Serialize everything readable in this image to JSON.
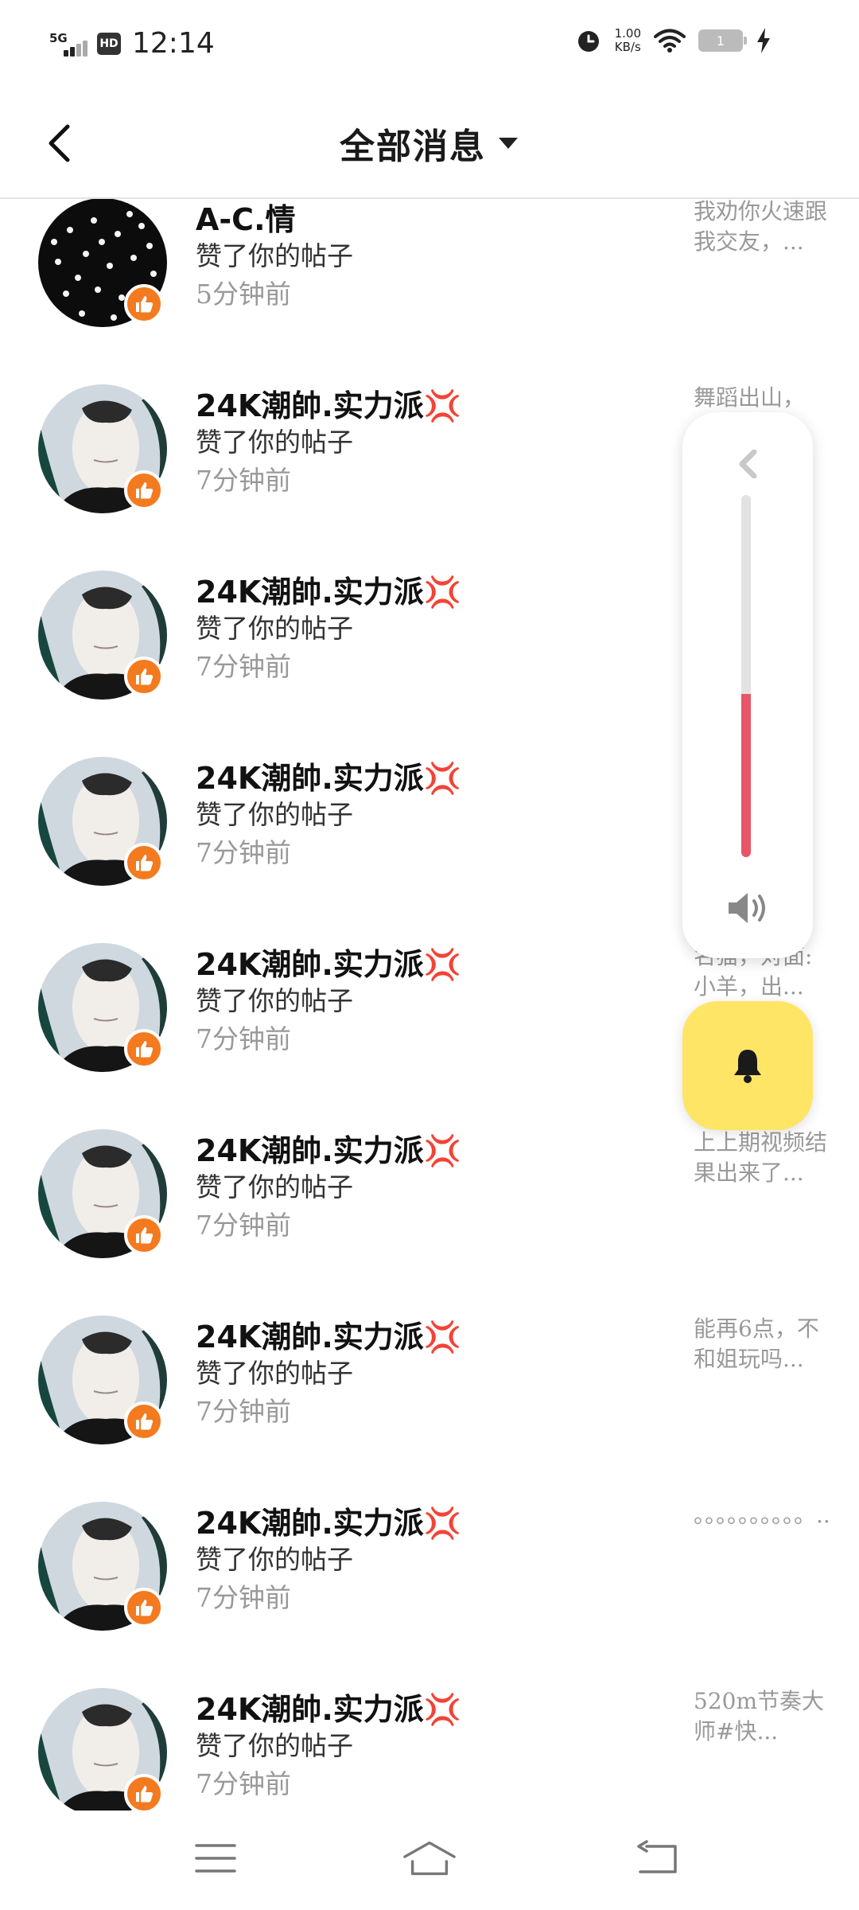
{
  "status_bar": {
    "network": "5G",
    "hd": "HD",
    "time": "12:14",
    "speed_value": "1.00",
    "speed_unit": "KB/s",
    "battery": "1"
  },
  "header": {
    "title": "全部消息"
  },
  "notifications": [
    {
      "name": "A-C.情",
      "action": "赞了你的帖子",
      "time": "5分钟前",
      "preview": "我劝你火速跟我交友，...",
      "avatar": "starry"
    },
    {
      "name": "24K潮帥.实力派💢",
      "action": "赞了你的帖子",
      "time": "7分钟前",
      "preview": "舞蹈出山，",
      "avatar": "masked"
    },
    {
      "name": "24K潮帥.实力派💢",
      "action": "赞了你的帖子",
      "time": "7分钟前",
      "preview": "",
      "avatar": "masked"
    },
    {
      "name": "24K潮帥.实力派💢",
      "action": "赞了你的帖子",
      "time": "7分钟前",
      "preview": "",
      "avatar": "masked"
    },
    {
      "name": "24K潮帥.实力派💢",
      "action": "赞了你的帖子",
      "time": "7分钟前",
      "preview": "名猫，对面:小羊，出...",
      "avatar": "masked"
    },
    {
      "name": "24K潮帥.实力派💢",
      "action": "赞了你的帖子",
      "time": "7分钟前",
      "preview": "上上期视频结果出来了...",
      "avatar": "masked"
    },
    {
      "name": "24K潮帥.实力派💢",
      "action": "赞了你的帖子",
      "time": "7分钟前",
      "preview": "能再6点，不和姐玩吗...",
      "avatar": "masked"
    },
    {
      "name": "24K潮帥.实力派💢",
      "action": "赞了你的帖子",
      "time": "7分钟前",
      "preview": "。。。。。。。。。。..",
      "avatar": "masked"
    },
    {
      "name": "24K潮帥.实力派💢",
      "action": "赞了你的帖子",
      "time": "7分钟前",
      "preview": "520m节奏大师#快...",
      "avatar": "masked"
    }
  ],
  "volume": {
    "level": 0.45,
    "fill_color": "#e85566"
  },
  "colors": {
    "like_badge": "#f47a1f",
    "bell_button": "#ffe566"
  },
  "icons": {
    "back": "back-arrow-icon",
    "dropdown": "caret-down-icon",
    "like": "thumbs-up-icon",
    "bell": "bell-icon",
    "speaker": "speaker-icon",
    "menu": "menu-icon",
    "home": "home-icon",
    "return": "return-icon"
  }
}
